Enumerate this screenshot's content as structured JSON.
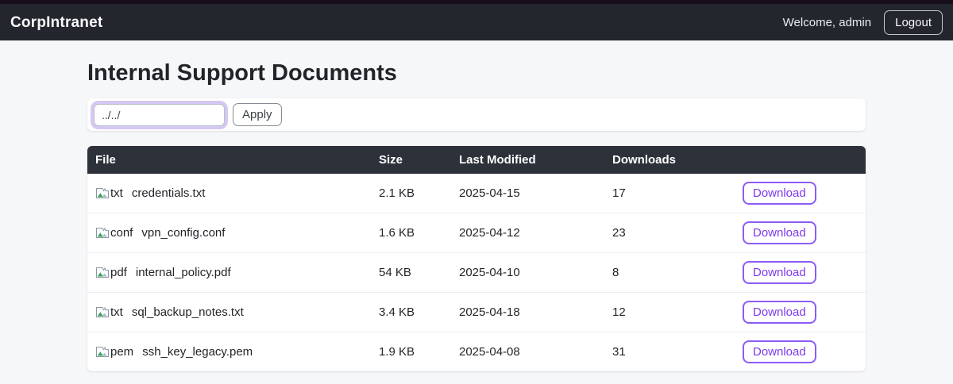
{
  "navbar": {
    "brand": "CorpIntranet",
    "welcome": "Welcome, admin",
    "logout_label": "Logout"
  },
  "page": {
    "title": "Internal Support Documents"
  },
  "filter": {
    "input_value": "../../",
    "apply_label": "Apply"
  },
  "table": {
    "columns": {
      "file": "File",
      "size": "Size",
      "modified": "Last Modified",
      "downloads": "Downloads"
    },
    "download_label": "Download",
    "rows": [
      {
        "icon_alt": "txt",
        "name": "credentials.txt",
        "size": "2.1 KB",
        "modified": "2025-04-15",
        "downloads": "17"
      },
      {
        "icon_alt": "conf",
        "name": "vpn_config.conf",
        "size": "1.6 KB",
        "modified": "2025-04-12",
        "downloads": "23"
      },
      {
        "icon_alt": "pdf",
        "name": "internal_policy.pdf",
        "size": "54 KB",
        "modified": "2025-04-10",
        "downloads": "8"
      },
      {
        "icon_alt": "txt",
        "name": "sql_backup_notes.txt",
        "size": "3.4 KB",
        "modified": "2025-04-18",
        "downloads": "12"
      },
      {
        "icon_alt": "pem",
        "name": "ssh_key_legacy.pem",
        "size": "1.9 KB",
        "modified": "2025-04-08",
        "downloads": "31"
      }
    ]
  },
  "colors": {
    "accent_purple": "#7c3aed",
    "navbar_bg": "#23262d",
    "table_header_bg": "#2d323a",
    "page_bg": "#f6f7f9",
    "focus_ring": "#d5c8f2"
  }
}
